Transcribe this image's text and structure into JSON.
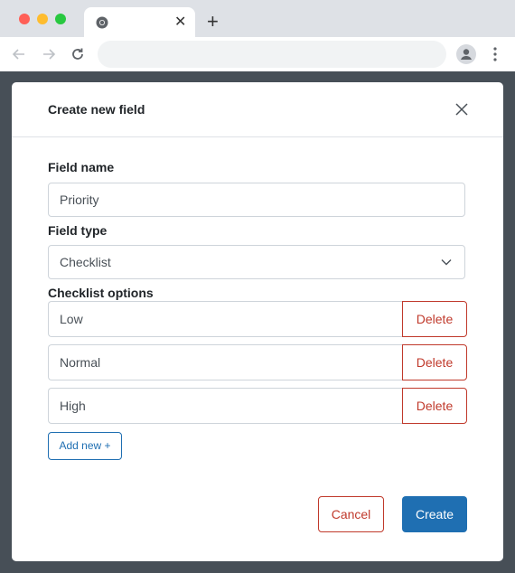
{
  "browser": {
    "tab_close_glyph": "✕",
    "new_tab_glyph": "+",
    "icons": [
      "chrome-favicon-icon",
      "back-arrow-icon",
      "forward-arrow-icon",
      "reload-icon",
      "star-icon",
      "profile-icon",
      "kebab-menu-icon"
    ]
  },
  "modal": {
    "title": "Create new field",
    "field_name_label": "Field name",
    "field_name_value": "Priority",
    "field_type_label": "Field type",
    "field_type_value": "Checklist",
    "checklist_label": "Checklist options",
    "options": [
      {
        "value": "Low",
        "delete_label": "Delete"
      },
      {
        "value": "Normal",
        "delete_label": "Delete"
      },
      {
        "value": "High",
        "delete_label": "Delete"
      }
    ],
    "add_new_label": "Add new +",
    "cancel_label": "Cancel",
    "create_label": "Create"
  },
  "colors": {
    "primary": "#1f6fb2",
    "danger": "#c0392b",
    "backdrop": "#474f57"
  }
}
